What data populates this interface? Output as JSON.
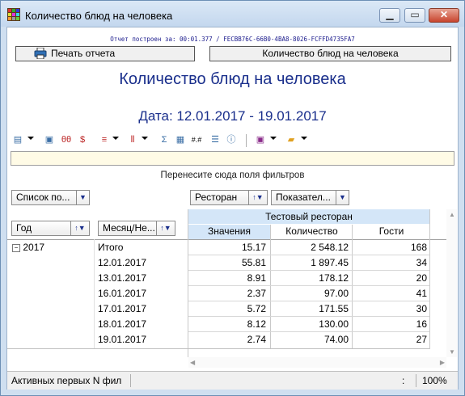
{
  "window": {
    "title": "Количество блюд на человека"
  },
  "report": {
    "id_text": "Отчет построен за: 00:01.377 / FECBB76C-66B0-4BA8-8026-FCFFD4735FA7",
    "print_label": "Печать отчета",
    "report_name_label": "Количество блюд на человека",
    "heading": "Количество блюд на человека",
    "date_range": "Дата: 12.01.2017 - 19.01.2017"
  },
  "pivot": {
    "filter_hint": "Перенесите сюда поля фильтров",
    "field_list_label": "Список по...",
    "column_fields": [
      "Ресторан",
      "Показател..."
    ],
    "row_fields": [
      "Год",
      "Месяц/Не..."
    ],
    "column_group": "Тестовый ресторан",
    "measure_headers": [
      "Значения",
      "Количество",
      "Гости"
    ],
    "year": "2017",
    "rows": [
      {
        "label": "Итого",
        "values": [
          "15.17",
          "2 548.12",
          "168"
        ]
      },
      {
        "label": "12.01.2017",
        "values": [
          "55.81",
          "1 897.45",
          "34"
        ]
      },
      {
        "label": "13.01.2017",
        "values": [
          "8.91",
          "178.12",
          "20"
        ]
      },
      {
        "label": "16.01.2017",
        "values": [
          "2.37",
          "97.00",
          "41"
        ]
      },
      {
        "label": "17.01.2017",
        "values": [
          "5.72",
          "171.55",
          "30"
        ]
      },
      {
        "label": "18.01.2017",
        "values": [
          "8.12",
          "130.00",
          "16"
        ]
      },
      {
        "label": "19.01.2017",
        "values": [
          "2.74",
          "74.00",
          "27"
        ]
      }
    ]
  },
  "status": {
    "left_text": "Активных первых N фил",
    "colon": ":",
    "zoom": "100%"
  }
}
